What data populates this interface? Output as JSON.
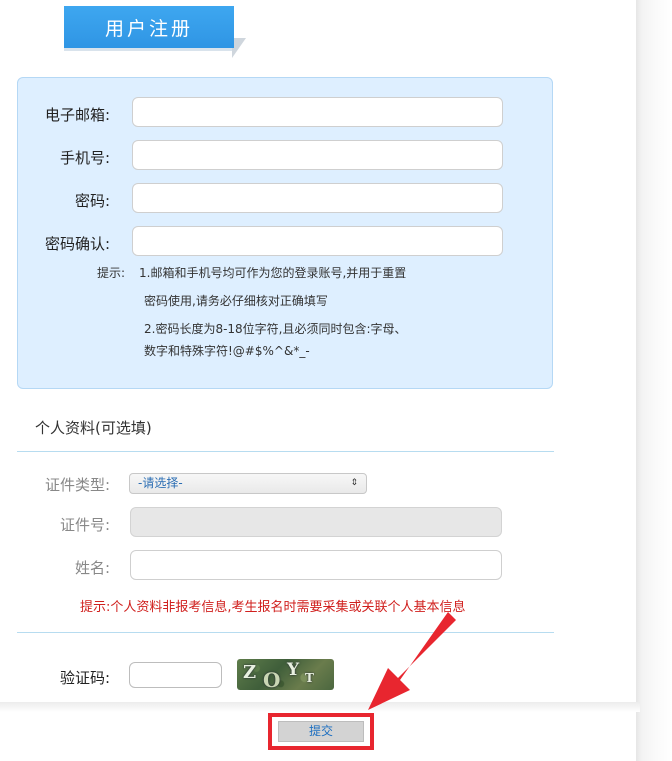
{
  "header": {
    "title": "用户注册"
  },
  "account": {
    "email_label": "电子邮箱:",
    "phone_label": "手机号:",
    "password_label": "密码:",
    "confirm_label": "密码确认:",
    "tip_prefix": "提示:",
    "tip_line1": "1.邮箱和手机号均可作为您的登录账号,并用于重置",
    "tip_line2": "密码使用,请务必仔细核对正确填写",
    "tip_line3": "2.密码长度为8-18位字符,且必须同时包含:字母、",
    "tip_line4": "数字和特殊字符!@#$%^&*_-"
  },
  "profile": {
    "section_title": "个人资料(可选填)",
    "id_type_label": "证件类型:",
    "id_type_selected": "-请选择-",
    "id_number_label": "证件号:",
    "name_label": "姓名:",
    "tip": "提示:个人资料非报考信息,考生报名时需要采集或关联个人基本信息"
  },
  "captcha": {
    "label": "验证码:",
    "image_text": "ZOYT"
  },
  "actions": {
    "submit_label": "提交"
  },
  "colors": {
    "title_blue": "#2f95e4",
    "panel_bg": "#deefff",
    "warning_red": "#d0201e",
    "highlight_red": "#e8262f"
  }
}
